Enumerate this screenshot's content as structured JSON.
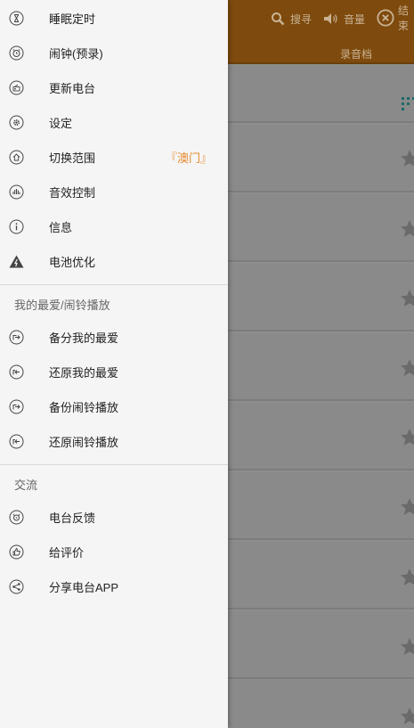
{
  "background": {
    "toolbar": {
      "search_label": "搜寻",
      "volume_label": "音量",
      "close_label": "结束"
    },
    "tabs": [
      "录音档"
    ]
  },
  "drawer": {
    "menu_items": [
      {
        "label": "睡眠定时",
        "icon": "hourglass-icon"
      },
      {
        "label": "闹钟(预录)",
        "icon": "alarm-clock-icon"
      },
      {
        "label": "更新电台",
        "icon": "update-station-icon"
      },
      {
        "label": "设定",
        "icon": "gear-icon"
      },
      {
        "label": "切换范围",
        "icon": "region-switch-icon",
        "extra": "『澳门』"
      },
      {
        "label": "音效控制",
        "icon": "equalizer-icon"
      },
      {
        "label": "信息",
        "icon": "info-icon"
      },
      {
        "label": "电池优化",
        "icon": "battery-warning-icon"
      }
    ],
    "favorites_section": {
      "title": "我的最爱/闹铃播放",
      "items": [
        {
          "label": "备分我的最爱",
          "icon": "backup-icon"
        },
        {
          "label": "还原我的最爱",
          "icon": "restore-icon"
        },
        {
          "label": "备份闹铃播放",
          "icon": "backup-icon"
        },
        {
          "label": "还原闹铃播放",
          "icon": "restore-icon"
        }
      ]
    },
    "community_section": {
      "title": "交流",
      "items": [
        {
          "label": "电台反馈",
          "icon": "feedback-icon"
        },
        {
          "label": "给评价",
          "icon": "thumbs-up-icon"
        },
        {
          "label": "分享电台APP",
          "icon": "share-icon"
        }
      ]
    }
  },
  "colors": {
    "accent": "#e8892a",
    "toolbar_dimmed": "#7e4a0d",
    "drawer_bg": "#f5f5f5"
  }
}
